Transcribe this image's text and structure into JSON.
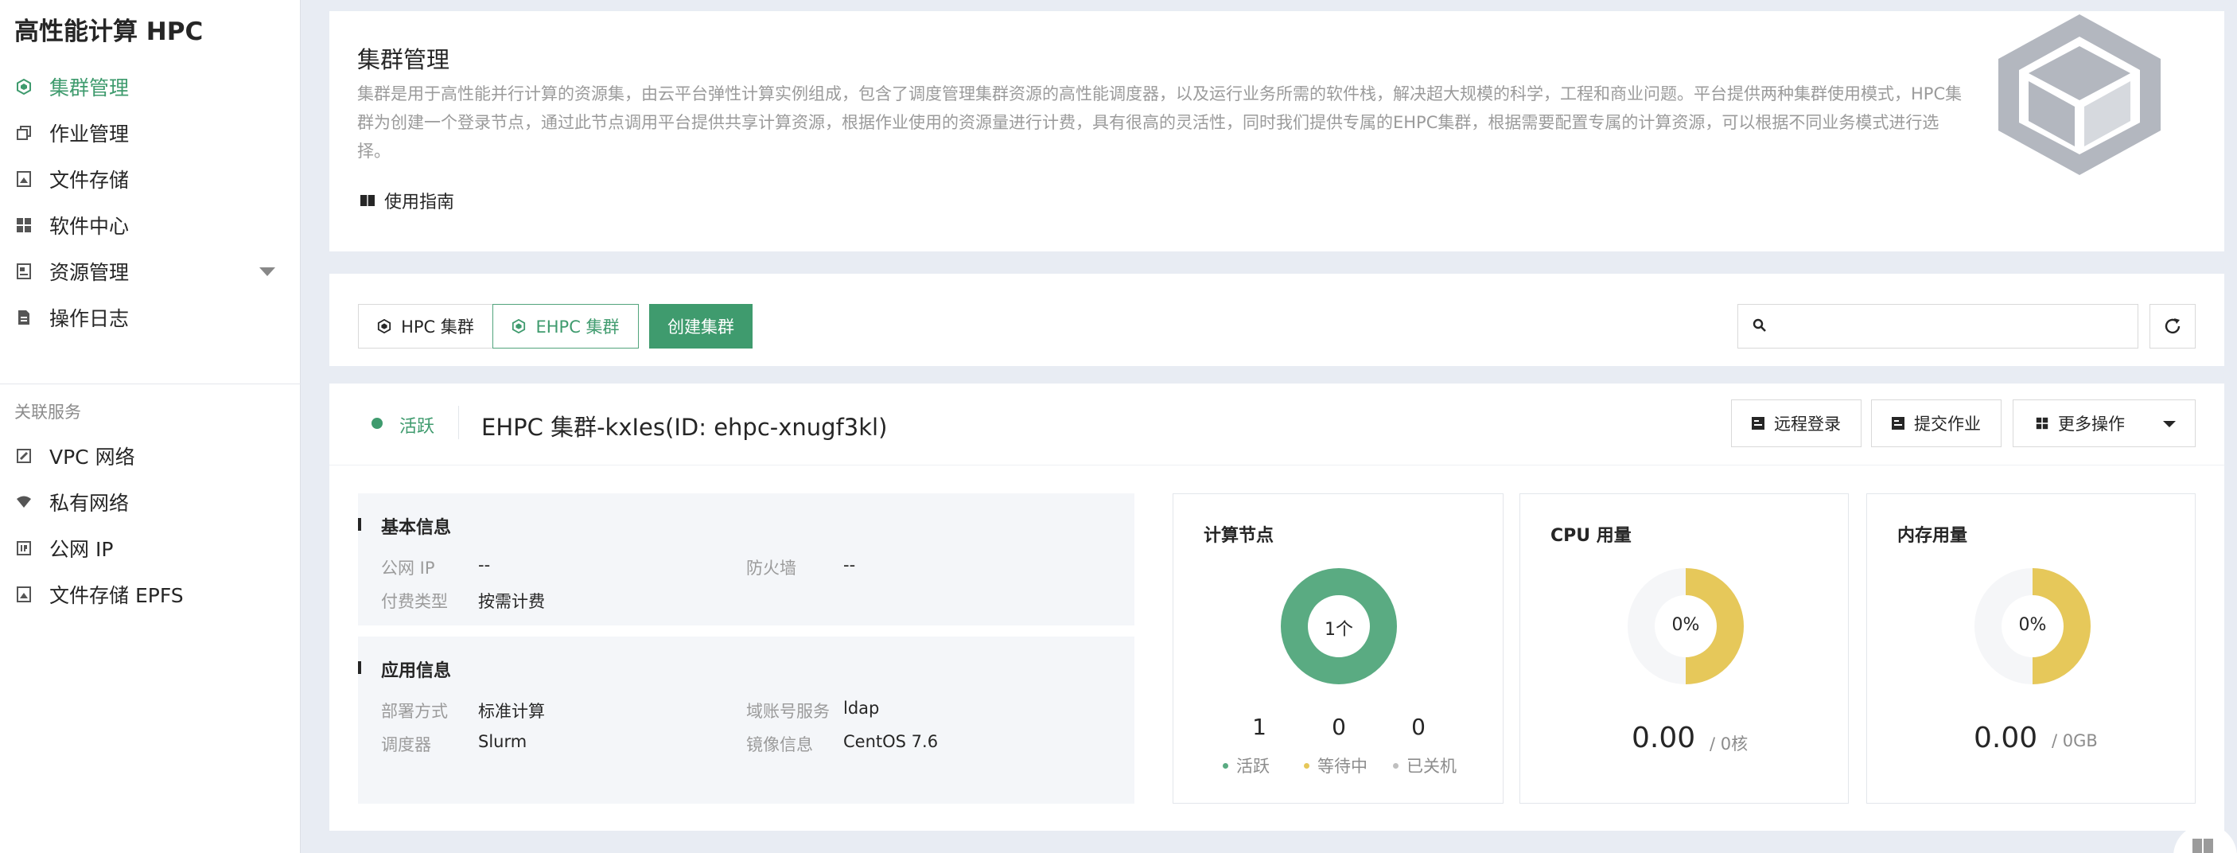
{
  "app": {
    "title": "高性能计算 HPC"
  },
  "sidebar": {
    "items": [
      {
        "label": "集群管理",
        "icon": "cluster-icon",
        "active": true
      },
      {
        "label": "作业管理",
        "icon": "jobs-icon"
      },
      {
        "label": "文件存储",
        "icon": "storage-icon"
      },
      {
        "label": "软件中心",
        "icon": "apps-icon"
      },
      {
        "label": "资源管理",
        "icon": "resource-icon",
        "expandable": true
      },
      {
        "label": "操作日志",
        "icon": "log-icon"
      }
    ],
    "section_title": "关联服务",
    "related": [
      {
        "label": "VPC 网络",
        "icon": "vpc-icon"
      },
      {
        "label": "私有网络",
        "icon": "wifi-icon"
      },
      {
        "label": "公网 IP",
        "icon": "ip-icon"
      },
      {
        "label": "文件存储 EPFS",
        "icon": "storage-icon"
      }
    ]
  },
  "intro": {
    "title": "集群管理",
    "description": "集群是用于高性能并行计算的资源集，由云平台弹性计算实例组成，包含了调度管理集群资源的高性能调度器，以及运行业务所需的软件栈，解决超大规模的科学，工程和商业问题。平台提供两种集群使用模式，HPC集群为创建一个登录节点，通过此节点调用平台提供共享计算资源，根据作业使用的资源量进行计费，具有很高的灵活性，同时我们提供专属的EHPC集群，根据需要配置专属的计算资源，可以根据不同业务模式进行选择。",
    "guide_label": "使用指南"
  },
  "toolbar": {
    "tab_hpc": "HPC 集群",
    "tab_ehpc": "EHPC 集群",
    "create_label": "创建集群",
    "search_placeholder": ""
  },
  "cluster": {
    "status": "活跃",
    "name": "EHPC 集群-kxIes(ID: ehpc-xnugf3kl)",
    "actions": {
      "remote_login": "远程登录",
      "submit_job": "提交作业",
      "more": "更多操作"
    },
    "basic": {
      "title": "基本信息",
      "public_ip_label": "公网 IP",
      "public_ip": "--",
      "firewall_label": "防火墙",
      "firewall": "--",
      "billing_label": "付费类型",
      "billing": "按需计费"
    },
    "app_info": {
      "title": "应用信息",
      "deploy_label": "部署方式",
      "deploy": "标准计算",
      "domain_label": "域账号服务",
      "domain": "ldap",
      "scheduler_label": "调度器",
      "scheduler": "Slurm",
      "image_label": "镜像信息",
      "image": "CentOS 7.6"
    },
    "compute_nodes": {
      "title": "计算节点",
      "center": "1个",
      "active_count": "1",
      "active_label": "活跃",
      "waiting_count": "0",
      "waiting_label": "等待中",
      "off_count": "0",
      "off_label": "已关机"
    },
    "cpu": {
      "title": "CPU 用量",
      "percent_label": "0%",
      "value": "0.00",
      "unit": "/ 0核"
    },
    "memory": {
      "title": "内存用量",
      "percent_label": "0%",
      "value": "0.00",
      "unit": "/ 0GB"
    }
  },
  "colors": {
    "accent": "#3f9b6e",
    "active_green": "#5aab82",
    "waiting_yellow": "#e6c85a",
    "off_gray": "#bfbfbf"
  }
}
